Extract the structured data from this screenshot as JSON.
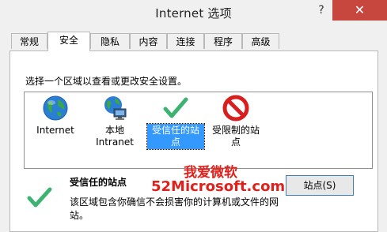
{
  "window": {
    "title": "Internet 选项",
    "help": "?",
    "close": "✕"
  },
  "tabs": [
    {
      "label": "常规"
    },
    {
      "label": "安全"
    },
    {
      "label": "隐私"
    },
    {
      "label": "内容"
    },
    {
      "label": "连接"
    },
    {
      "label": "程序"
    },
    {
      "label": "高级"
    }
  ],
  "active_tab": "安全",
  "security": {
    "instruction": "选择一个区域以查看或更改安全设置。",
    "zones": [
      {
        "label": "Internet",
        "icon": "globe-icon"
      },
      {
        "label": "本地\nIntranet",
        "icon": "local-intranet-icon"
      },
      {
        "label": "受信任的站\n点",
        "icon": "checkmark-icon",
        "selected": true
      },
      {
        "label": "受限制的站\n点",
        "icon": "prohibited-icon"
      }
    ],
    "selected_title": "受信任的站点",
    "selected_desc": "该区域包含你确信不会损害你的计算机或文件的网站。",
    "sites_button": "站点(S)"
  },
  "watermark": {
    "line1": "我爱微软",
    "line2": "52Microsoft.com"
  },
  "colors": {
    "close": "#c7463e",
    "selection": "#3399ff",
    "watermark": "#e0201b",
    "check": "#3cb371"
  }
}
